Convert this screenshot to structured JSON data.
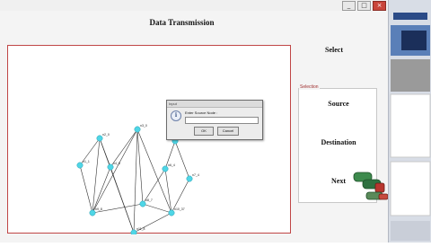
{
  "window": {
    "controls": {
      "minimize": "_",
      "maximize": "□",
      "close": "×"
    }
  },
  "page_title": "Data Transmission",
  "right_panel": {
    "select_heading": "Select",
    "selection_label": "Selection",
    "source_label": "Source",
    "destination_label": "Destination",
    "next_label": "Next"
  },
  "dialog": {
    "title": "Input",
    "prompt": "Enter Source Node :",
    "input_value": "",
    "ok_label": "OK",
    "cancel_label": "Cancel"
  },
  "graph": {
    "node_color": "#4fd6e6",
    "nodes": [
      {
        "label": "n1_1"
      },
      {
        "label": "n2_0"
      },
      {
        "label": "n3_0"
      },
      {
        "label": "n4_8"
      },
      {
        "label": "n5_6"
      },
      {
        "label": "n6_4"
      },
      {
        "label": "n7_4"
      },
      {
        "label": "n8_7"
      },
      {
        "label": "n9_8"
      },
      {
        "label": "n10_37"
      },
      {
        "label": "n11_8"
      }
    ]
  },
  "colors": {
    "panel_border": "#c04646",
    "cylinder_green": "#3d8a4d",
    "cylinder_red": "#b8362f"
  }
}
